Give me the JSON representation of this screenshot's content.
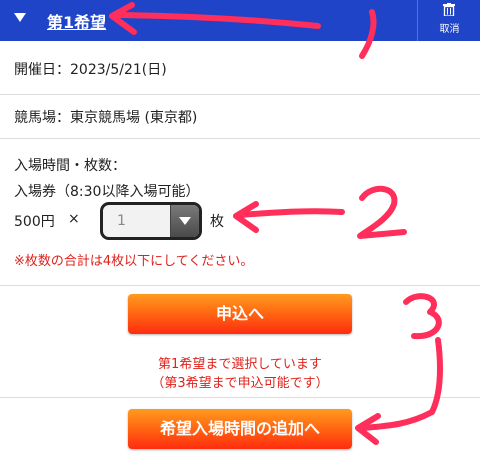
{
  "header": {
    "title": "第1希望",
    "cancel_label": "取消",
    "color": "#1f44c8"
  },
  "details": {
    "date": "開催日：2023/5/21(日)",
    "venue": "競馬場：東京競馬場 (東京都)",
    "time_label": "入場時間・枚数：",
    "ticket_type": "入場券（8:30以降入場可能）",
    "price": "500円",
    "times": "×",
    "quantity_value": "1",
    "unit": "枚",
    "warning": "※枚数の合計は4枚以下にしてください。"
  },
  "actions": {
    "apply_label": "申込へ",
    "note_line1": "第1希望まで選択しています",
    "note_line2": "（第3希望まで申込可能です）",
    "add_label": "希望入場時間の追加へ"
  },
  "annotations": {
    "color": "#ff2e5a",
    "n1": "1",
    "n2": "2",
    "n3": "3"
  }
}
